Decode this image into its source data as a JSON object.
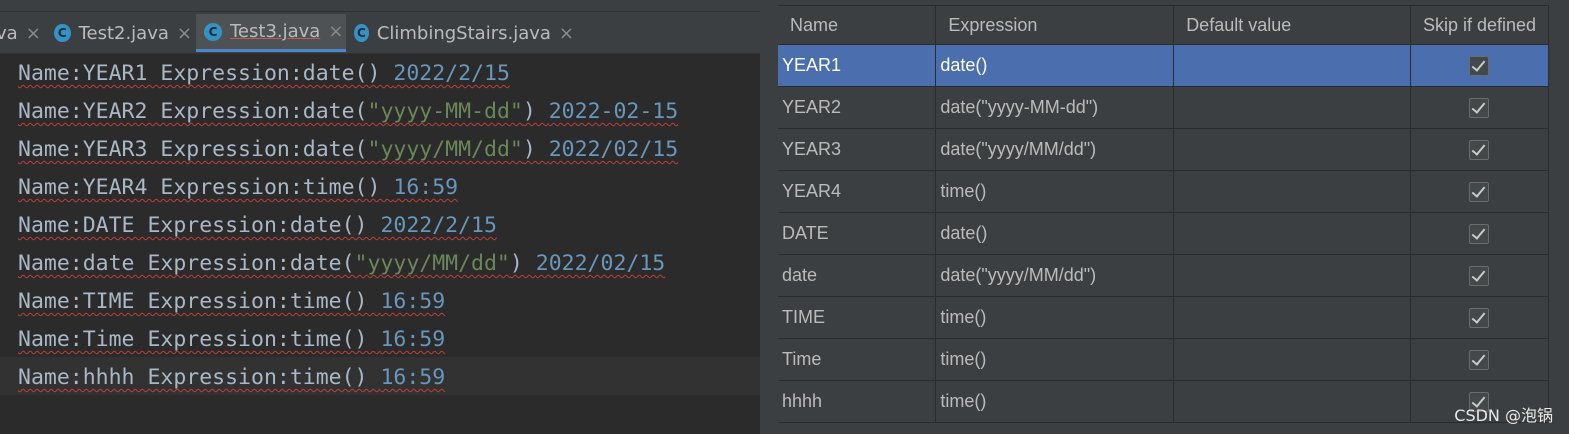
{
  "editor": {
    "tabs": [
      {
        "label": "va",
        "icon": "java-class-icon",
        "active": false
      },
      {
        "label": "Test2.java",
        "icon": "java-class-icon",
        "active": false
      },
      {
        "label": "Test3.java",
        "icon": "java-class-icon",
        "active": true
      },
      {
        "label": "ClimbingStairs.java",
        "icon": "java-class-icon",
        "active": false
      }
    ],
    "lines": [
      {
        "prefix": "Name:YEAR1 Expression:date() ",
        "str": "",
        "suffix": "",
        "value": "2022/2/15"
      },
      {
        "prefix": "Name:YEAR2 Expression:date(",
        "str": "\"yyyy-MM-dd\"",
        "suffix": ") ",
        "value": "2022-02-15"
      },
      {
        "prefix": "Name:YEAR3 Expression:date(",
        "str": "\"yyyy/MM/dd\"",
        "suffix": ") ",
        "value": "2022/02/15"
      },
      {
        "prefix": "Name:YEAR4 Expression:time() ",
        "str": "",
        "suffix": "",
        "value": "16:59"
      },
      {
        "prefix": "Name:DATE Expression:date() ",
        "str": "",
        "suffix": "",
        "value": "2022/2/15"
      },
      {
        "prefix": "Name:date Expression:date(",
        "str": "\"yyyy/MM/dd\"",
        "suffix": ") ",
        "value": "2022/02/15"
      },
      {
        "prefix": "Name:TIME Expression:time() ",
        "str": "",
        "suffix": "",
        "value": "16:59"
      },
      {
        "prefix": "Name:Time Expression:time() ",
        "str": "",
        "suffix": "",
        "value": "16:59"
      },
      {
        "prefix": "Name:hhhh Expression:time() ",
        "str": "",
        "suffix": "",
        "value": "16:59"
      }
    ]
  },
  "variables_table": {
    "headers": [
      "Name",
      "Expression",
      "Default value",
      "Skip if defined"
    ],
    "rows": [
      {
        "name": "YEAR1",
        "expression": "date()",
        "default": "",
        "skip": true,
        "selected": true
      },
      {
        "name": "YEAR2",
        "expression": "date(\"yyyy-MM-dd\")",
        "default": "",
        "skip": true,
        "selected": false
      },
      {
        "name": "YEAR3",
        "expression": "date(\"yyyy/MM/dd\")",
        "default": "",
        "skip": true,
        "selected": false
      },
      {
        "name": "YEAR4",
        "expression": "time()",
        "default": "",
        "skip": true,
        "selected": false
      },
      {
        "name": "DATE",
        "expression": "date()",
        "default": "",
        "skip": true,
        "selected": false
      },
      {
        "name": "date",
        "expression": "date(\"yyyy/MM/dd\")",
        "default": "",
        "skip": true,
        "selected": false
      },
      {
        "name": "TIME",
        "expression": "time()",
        "default": "",
        "skip": true,
        "selected": false
      },
      {
        "name": "Time",
        "expression": "time()",
        "default": "",
        "skip": true,
        "selected": false
      },
      {
        "name": "hhhh",
        "expression": "time()",
        "default": "",
        "skip": true,
        "selected": false
      }
    ]
  },
  "watermark": "CSDN @泡锅",
  "colors": {
    "selection": "#4b6eaf",
    "string": "#6a8759",
    "number": "#6897bb",
    "text": "#a9b7c6",
    "background": "#2b2b2b",
    "panel": "#3c3f41"
  }
}
